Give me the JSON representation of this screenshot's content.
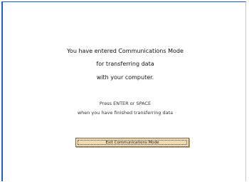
{
  "message": {
    "line1": "You have entered Communications Mode",
    "line2": "for transferring data",
    "line3": "with your computer.",
    "instruction_line1": "Press ENTER or SPACE",
    "instruction_line2": "when you have finished transferring data"
  },
  "exit_button": {
    "label": "Exit Communications Mode"
  },
  "colors": {
    "window_border": "#1f5fbf",
    "button_fill": "#f3dcb0"
  }
}
